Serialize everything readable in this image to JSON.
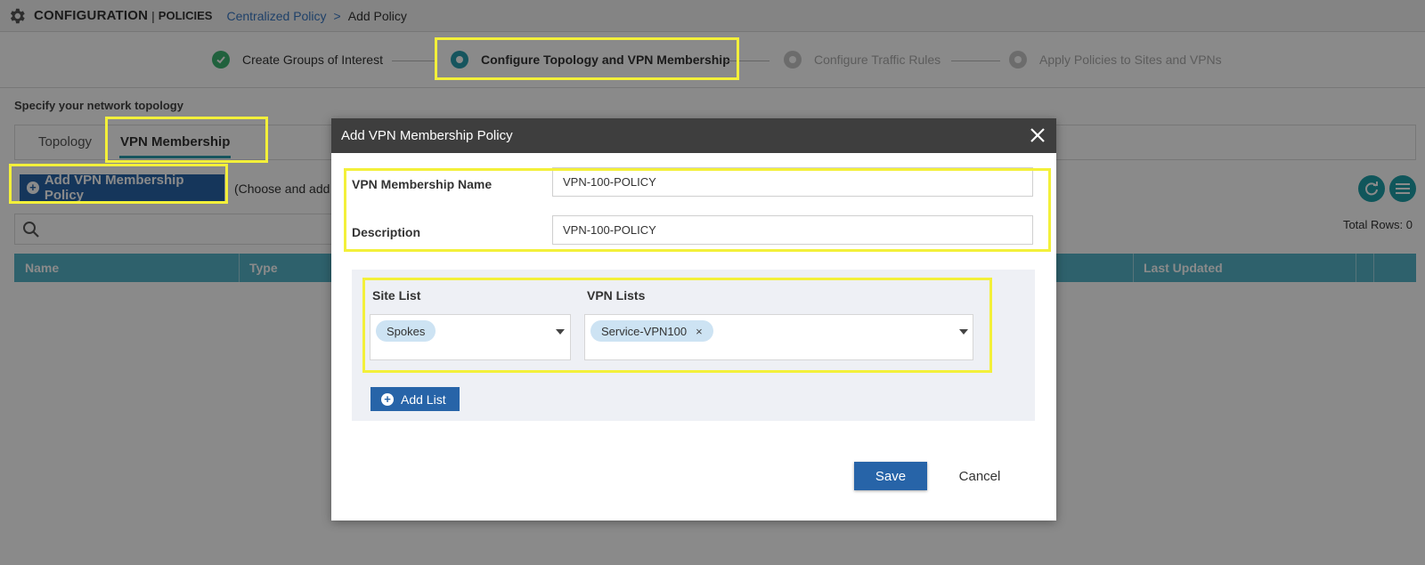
{
  "header": {
    "title": "CONFIGURATION",
    "separator": "|",
    "subtitle": "POLICIES",
    "breadcrumb_link": "Centralized Policy",
    "breadcrumb_sep": ">",
    "breadcrumb_current": "Add Policy"
  },
  "steps": [
    {
      "label": "Create Groups of Interest",
      "state": "done"
    },
    {
      "label": "Configure Topology and VPN Membership",
      "state": "active"
    },
    {
      "label": "Configure Traffic Rules",
      "state": "pending"
    },
    {
      "label": "Apply Policies to Sites and VPNs",
      "state": "pending"
    }
  ],
  "page": {
    "section_label": "Specify your network topology",
    "tabs": [
      "Topology",
      "VPN Membership"
    ],
    "add_button": "Add VPN Membership Policy",
    "choose_text": "(Choose and add",
    "total_rows": "Total Rows: 0",
    "table_headers": [
      "Name",
      "Type",
      "Last Updated"
    ]
  },
  "modal": {
    "title": "Add VPN Membership Policy",
    "name_label": "VPN Membership Name",
    "name_value": "VPN-100-POLICY",
    "description_label": "Description",
    "description_value": "VPN-100-POLICY",
    "site_list_label": "Site List",
    "site_list_selected": "Spokes",
    "vpn_lists_label": "VPN Lists",
    "vpn_lists_selected": "Service-VPN100",
    "chip_remove": "×",
    "add_list_button": "Add List",
    "save_button": "Save",
    "cancel_button": "Cancel"
  },
  "colors": {
    "accent_blue": "#2764a8",
    "teal": "#55b4c8",
    "highlight": "#f3f03a",
    "done_green": "#3cb371"
  },
  "icons": [
    "gear-icon",
    "check-icon",
    "step-dot-icon",
    "plus-icon",
    "search-icon",
    "refresh-icon",
    "menu-icon",
    "close-icon",
    "chevron-down-icon"
  ]
}
